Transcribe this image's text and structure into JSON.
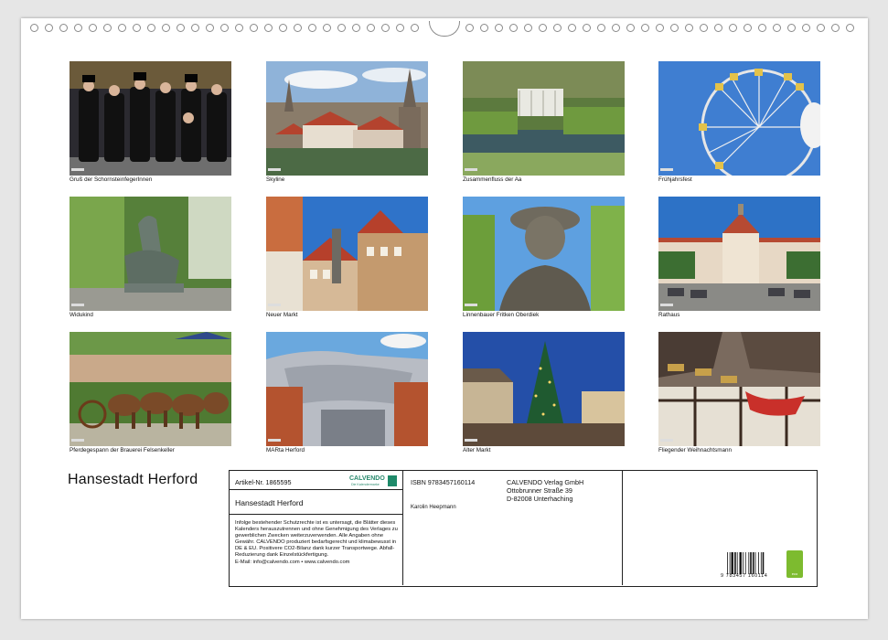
{
  "calendar": {
    "title": "Hansestadt Herford"
  },
  "photos": [
    {
      "caption": "Gruß der SchornsteinfegerInnen"
    },
    {
      "caption": "Skyline"
    },
    {
      "caption": "Zusammenfluss der Aa"
    },
    {
      "caption": "Frühjahrsfest"
    },
    {
      "caption": "Widukind"
    },
    {
      "caption": "Neuer Markt"
    },
    {
      "caption": "Linnenbauer Fritken Oberdiek"
    },
    {
      "caption": "Rathaus"
    },
    {
      "caption": "Pferdegespann der Brauerei Felsenkeller"
    },
    {
      "caption": "MARta Herford"
    },
    {
      "caption": "Alter Markt"
    },
    {
      "caption": "Fliegender Weihnachtsmann"
    }
  ],
  "info": {
    "article": "Artikel-Nr. 1865595",
    "product_title": "Hansestadt Herford",
    "logo_name": "CALVENDO",
    "logo_tagline": "Die Kalendermarke",
    "legal_text": "Infolge bestehender Schutzrechte ist es untersagt, die Blätter dieses Kalenders herauszutrennen und ohne Genehmigung des Verlages zu gewerblichen Zwecken weiterzuverwenden. Alle Angaben ohne Gewähr. CALVENDO produziert bedarfsgerecht und klimabewusst in DE & EU. Positivere CO2-Bilanz dank kurzer Transportwege. Abfall-Reduzierung dank Einzelstückfertigung.",
    "email": "E-Mail: info@calvendo.com • www.calvendo.com",
    "isbn": "ISBN 9783457160114",
    "author": "Karolin Heepmann",
    "publisher_name": "CALVENDO Verlag GmbH",
    "publisher_street": "Ottobrunner Straße 39",
    "publisher_city": "D-82008 Unterhaching",
    "barcode_number": "9 783457 160114",
    "eco_label": "eco"
  }
}
